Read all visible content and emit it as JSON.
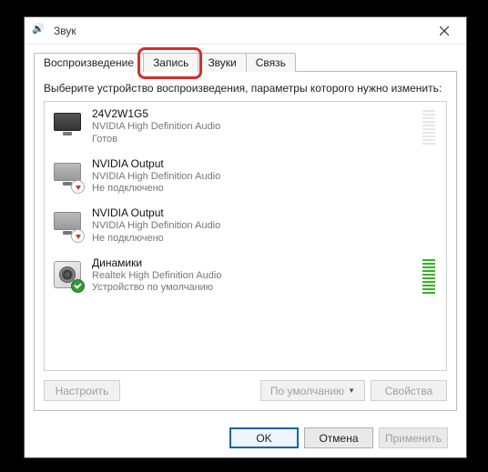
{
  "window": {
    "title": "Звук"
  },
  "tabs": [
    {
      "label": "Воспроизведение",
      "active": true
    },
    {
      "label": "Запись",
      "active": false
    },
    {
      "label": "Звуки",
      "active": false
    },
    {
      "label": "Связь",
      "active": false
    }
  ],
  "highlighted_tab_index": 1,
  "instruction": "Выберите устройство воспроизведения, параметры которого нужно изменить:",
  "devices": [
    {
      "name": "24V2W1G5",
      "driver": "NVIDIA High Definition Audio",
      "status": "Готов",
      "icon": "monitor",
      "overlay": null,
      "level": "dim"
    },
    {
      "name": "NVIDIA Output",
      "driver": "NVIDIA High Definition Audio",
      "status": "Не подключено",
      "icon": "monitor-dim",
      "overlay": "down",
      "level": null
    },
    {
      "name": "NVIDIA Output",
      "driver": "NVIDIA High Definition Audio",
      "status": "Не подключено",
      "icon": "monitor-dim",
      "overlay": "down",
      "level": null
    },
    {
      "name": "Динамики",
      "driver": "Realtek High Definition Audio",
      "status": "Устройство по умолчанию",
      "icon": "speaker",
      "overlay": "check",
      "level": "active"
    }
  ],
  "panel_buttons": {
    "configure": "Настроить",
    "default": "По умолчанию",
    "properties": "Свойства"
  },
  "dialog_buttons": {
    "ok": "OK",
    "cancel": "Отмена",
    "apply": "Применить"
  }
}
